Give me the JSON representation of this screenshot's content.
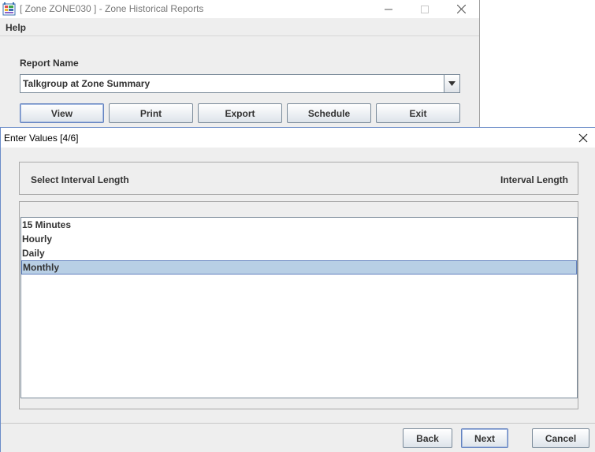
{
  "background_window": {
    "title": "[ Zone ZONE030 ] - Zone Historical Reports",
    "menu": [
      "Help"
    ],
    "report_name_label": "Report Name",
    "report_name_value": "Talkgroup at Zone Summary",
    "buttons": [
      "View",
      "Print",
      "Export",
      "Schedule",
      "Exit"
    ]
  },
  "dialog": {
    "title": "Enter Values [4/6]",
    "header_left": "Select Interval Length",
    "header_right": "Interval Length",
    "options": [
      "15 Minutes",
      "Hourly",
      "Daily",
      "Monthly"
    ],
    "selected_option": "Monthly",
    "buttons": {
      "back": "Back",
      "next": "Next",
      "cancel": "Cancel"
    }
  },
  "icons": {
    "app": "report-app-icon",
    "minimize": "minimize-icon",
    "maximize": "maximize-icon",
    "close": "close-icon",
    "dropdown": "chevron-down-icon"
  },
  "colors": {
    "selection": "#b8cfe5",
    "focus_border": "#6382bf",
    "panel_bg": "#eeeeee"
  }
}
